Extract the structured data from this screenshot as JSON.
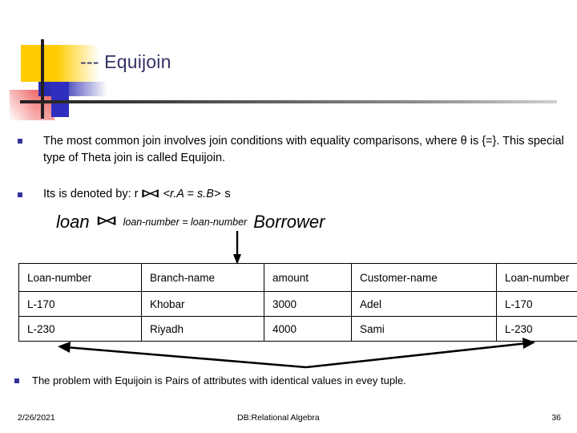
{
  "slide": {
    "title": "--- Equijoin",
    "title_color": "#333366"
  },
  "bullets": [
    {
      "id": "bullet-1",
      "text": "The most common join involves join conditions with equality comparisons, where θ is {=}. This special type of Theta join is called Equijoin."
    },
    {
      "id": "bullet-2",
      "lead": "Its is denoted by: r",
      "join_symbol": "⋈",
      "condition": "<r.A = s.B>",
      "trail": "s"
    },
    {
      "id": "bullet-3",
      "text": "The problem with Equijoin is Pairs of attributes with identical values in evey tuple."
    }
  ],
  "expression": {
    "left_relation": "loan",
    "join_symbol": "⋈",
    "condition": "loan-number = loan-number",
    "right_relation": "Borrower"
  },
  "table": {
    "headers": [
      {
        "label": "Loan-number",
        "color": "#cc0000"
      },
      {
        "label": "Branch-name",
        "color": "#000000"
      },
      {
        "label": "amount",
        "color": "#000000"
      },
      {
        "label": "Customer-name",
        "color": "#000000"
      },
      {
        "label": "Loan-number",
        "color": "#cc0000"
      }
    ],
    "rows": [
      [
        "L-170",
        "Khobar",
        "3000",
        "Adel",
        "L-170"
      ],
      [
        "L-230",
        "Riyadh",
        "4000",
        "Sami",
        "L-230"
      ]
    ]
  },
  "footer": {
    "date": "2/26/2021",
    "center": "DB:Relational Algebra",
    "page": "36"
  }
}
